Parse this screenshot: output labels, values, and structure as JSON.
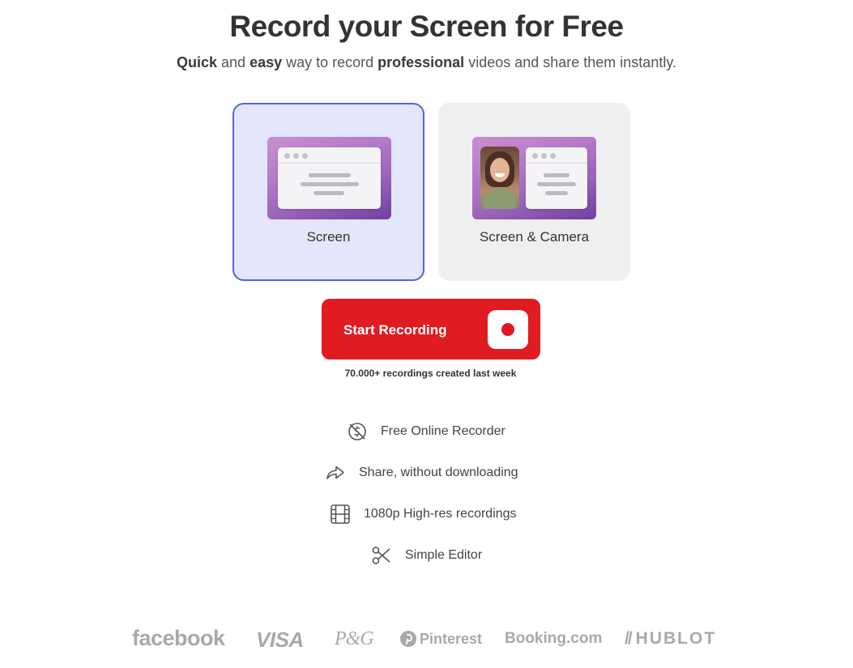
{
  "header": {
    "title": "Record your Screen for Free",
    "subtitle": {
      "w1": "Quick",
      "t1": " and ",
      "w2": "easy",
      "t2": " way to record ",
      "w3": "professional",
      "t3": " videos and share them instantly."
    }
  },
  "modes": [
    {
      "label": "Screen",
      "selected": true
    },
    {
      "label": "Screen & Camera",
      "selected": false
    }
  ],
  "record": {
    "button_label": "Start Recording",
    "stat": "70.000+ recordings created last week"
  },
  "features": [
    {
      "icon": "free-dollar-icon",
      "label": "Free Online Recorder"
    },
    {
      "icon": "share-arrow-icon",
      "label": "Share, without downloading"
    },
    {
      "icon": "film-icon",
      "label": "1080p High-res recordings"
    },
    {
      "icon": "scissors-icon",
      "label": "Simple Editor"
    }
  ],
  "logos": [
    "facebook",
    "VISA",
    "P&G",
    "Pinterest",
    "Booking.com",
    "HUBLOT"
  ],
  "colors": {
    "accent_red": "#e11b22",
    "selected_border": "#5a62e0",
    "selected_bg": "#e4e6fb",
    "card_bg": "#efeff1",
    "logo_gray": "#a9a9ad"
  }
}
